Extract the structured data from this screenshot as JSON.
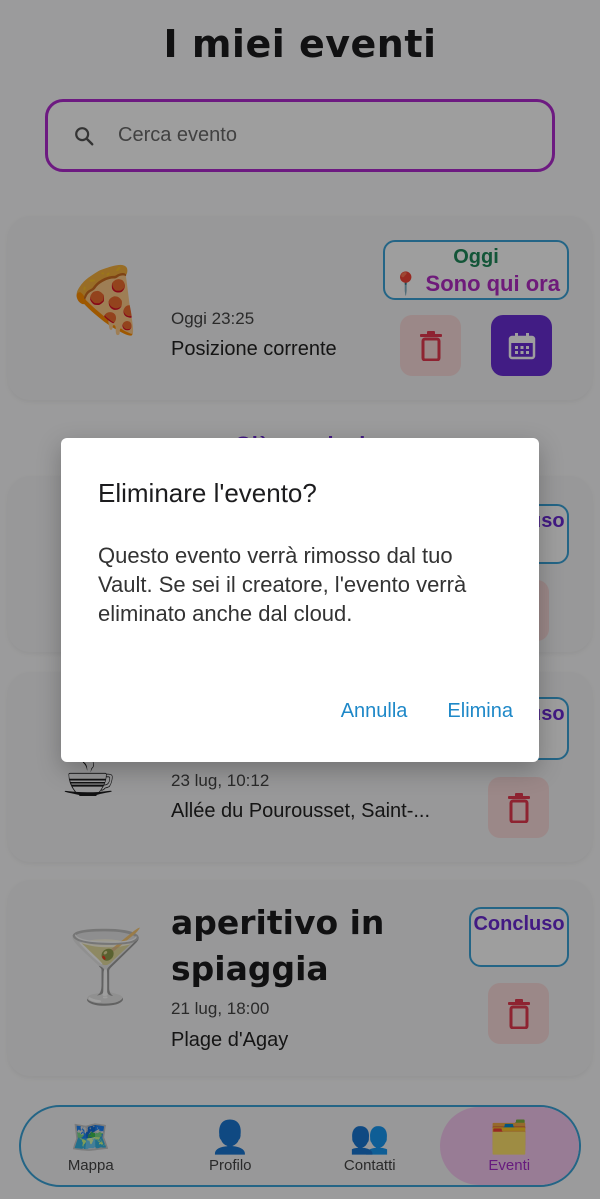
{
  "header": {
    "title": "I miei eventi"
  },
  "search": {
    "placeholder": "Cerca evento"
  },
  "events": [
    {
      "emoji": "🍕",
      "title": "",
      "when": "Oggi 23:25",
      "place": "Posizione corrente",
      "status_line1": "Oggi",
      "status_line2": "📍 Sono qui ora"
    },
    {
      "emoji": "",
      "title": "",
      "when": "",
      "place": "",
      "status": "Concluso"
    },
    {
      "emoji": "☕",
      "title": "",
      "when": "23 lug, 10:12",
      "place": "Allée du Pourousset, Saint-...",
      "status": "Concluso"
    },
    {
      "emoji": "🍸",
      "title": "aperitivo in spiaggia",
      "when": "21 lug, 18:00",
      "place": "Plage d'Agay",
      "status": "Concluso"
    }
  ],
  "section": {
    "past_label": "Già conclusi"
  },
  "dialog": {
    "title": "Eliminare l'evento?",
    "body": "Questo evento verrà rimosso dal tuo Vault. Se sei il creatore, l'evento verrà eliminato anche dal cloud.",
    "cancel_label": "Annulla",
    "confirm_label": "Elimina"
  },
  "nav": {
    "items": [
      {
        "icon": "🗺️",
        "label": "Mappa"
      },
      {
        "icon": "👤",
        "label": "Profilo"
      },
      {
        "icon": "👥",
        "label": "Contatti"
      },
      {
        "icon": "🗂️",
        "label": "Eventi"
      }
    ]
  },
  "colors": {
    "accent": "#b02ad0",
    "status_border": "#3aa3d9",
    "calendar": "#6a2ed6",
    "danger_bg": "#fadcdc",
    "danger": "#e53950"
  }
}
